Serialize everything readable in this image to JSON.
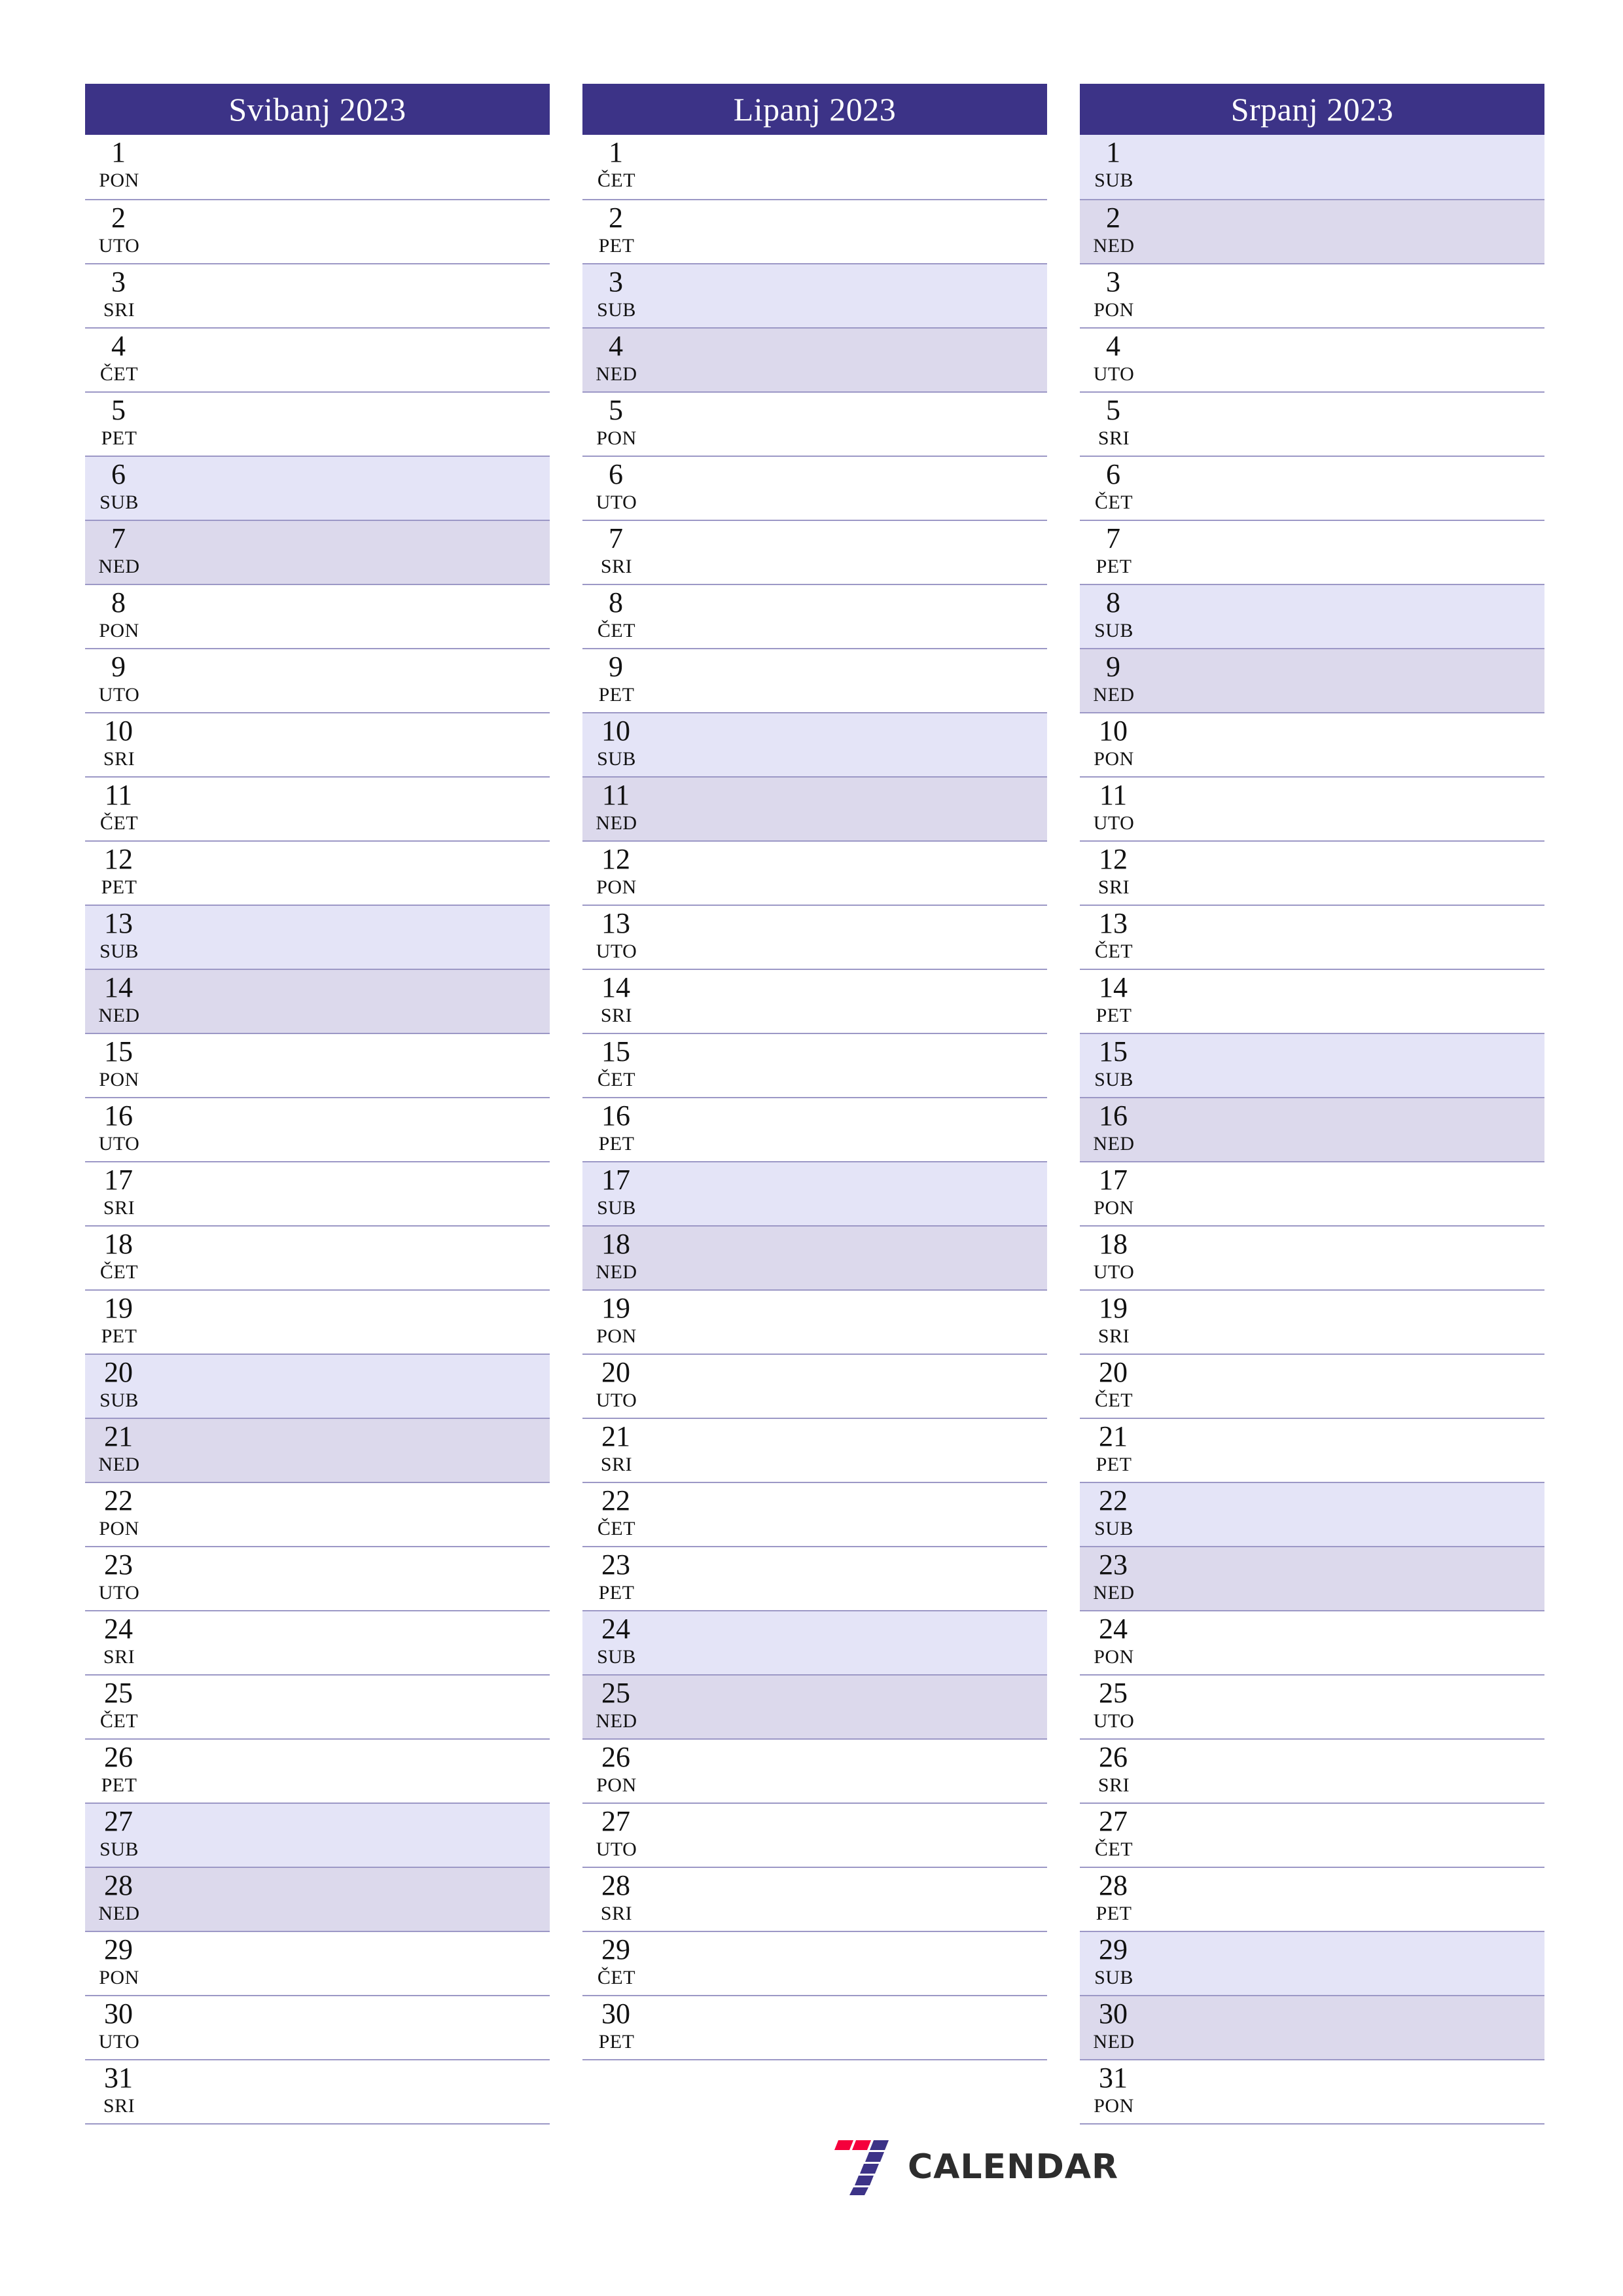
{
  "brand": {
    "logo_mark_name": "seven-logo-mark",
    "logo_text": "CALENDAR",
    "color_red": "#f5003c",
    "color_indigo": "#3c3387",
    "color_text": "#2d2d2d"
  },
  "theme": {
    "header_bg": "#3c3387",
    "header_text": "#ffffff",
    "saturday_bg": "#e4e4f7",
    "sunday_bg": "#dcd9ec",
    "rule_color": "#9c98c6",
    "day_text": "#111111",
    "page_bg": "#ffffff"
  },
  "language": "hr",
  "weekday_labels": {
    "mon": "PON",
    "tue": "UTO",
    "wed": "SRI",
    "thu": "ČET",
    "fri": "PET",
    "sat": "SUB",
    "sun": "NED"
  },
  "months": [
    {
      "title": "Svibanj 2023",
      "name": "Svibanj",
      "year": "2023",
      "days": [
        {
          "num": "1",
          "wd": "PON",
          "type": "weekday"
        },
        {
          "num": "2",
          "wd": "UTO",
          "type": "weekday"
        },
        {
          "num": "3",
          "wd": "SRI",
          "type": "weekday"
        },
        {
          "num": "4",
          "wd": "ČET",
          "type": "weekday"
        },
        {
          "num": "5",
          "wd": "PET",
          "type": "weekday"
        },
        {
          "num": "6",
          "wd": "SUB",
          "type": "sat"
        },
        {
          "num": "7",
          "wd": "NED",
          "type": "sun"
        },
        {
          "num": "8",
          "wd": "PON",
          "type": "weekday"
        },
        {
          "num": "9",
          "wd": "UTO",
          "type": "weekday"
        },
        {
          "num": "10",
          "wd": "SRI",
          "type": "weekday"
        },
        {
          "num": "11",
          "wd": "ČET",
          "type": "weekday"
        },
        {
          "num": "12",
          "wd": "PET",
          "type": "weekday"
        },
        {
          "num": "13",
          "wd": "SUB",
          "type": "sat"
        },
        {
          "num": "14",
          "wd": "NED",
          "type": "sun"
        },
        {
          "num": "15",
          "wd": "PON",
          "type": "weekday"
        },
        {
          "num": "16",
          "wd": "UTO",
          "type": "weekday"
        },
        {
          "num": "17",
          "wd": "SRI",
          "type": "weekday"
        },
        {
          "num": "18",
          "wd": "ČET",
          "type": "weekday"
        },
        {
          "num": "19",
          "wd": "PET",
          "type": "weekday"
        },
        {
          "num": "20",
          "wd": "SUB",
          "type": "sat"
        },
        {
          "num": "21",
          "wd": "NED",
          "type": "sun"
        },
        {
          "num": "22",
          "wd": "PON",
          "type": "weekday"
        },
        {
          "num": "23",
          "wd": "UTO",
          "type": "weekday"
        },
        {
          "num": "24",
          "wd": "SRI",
          "type": "weekday"
        },
        {
          "num": "25",
          "wd": "ČET",
          "type": "weekday"
        },
        {
          "num": "26",
          "wd": "PET",
          "type": "weekday"
        },
        {
          "num": "27",
          "wd": "SUB",
          "type": "sat"
        },
        {
          "num": "28",
          "wd": "NED",
          "type": "sun"
        },
        {
          "num": "29",
          "wd": "PON",
          "type": "weekday"
        },
        {
          "num": "30",
          "wd": "UTO",
          "type": "weekday"
        },
        {
          "num": "31",
          "wd": "SRI",
          "type": "weekday"
        }
      ]
    },
    {
      "title": "Lipanj 2023",
      "name": "Lipanj",
      "year": "2023",
      "days": [
        {
          "num": "1",
          "wd": "ČET",
          "type": "weekday"
        },
        {
          "num": "2",
          "wd": "PET",
          "type": "weekday"
        },
        {
          "num": "3",
          "wd": "SUB",
          "type": "sat"
        },
        {
          "num": "4",
          "wd": "NED",
          "type": "sun"
        },
        {
          "num": "5",
          "wd": "PON",
          "type": "weekday"
        },
        {
          "num": "6",
          "wd": "UTO",
          "type": "weekday"
        },
        {
          "num": "7",
          "wd": "SRI",
          "type": "weekday"
        },
        {
          "num": "8",
          "wd": "ČET",
          "type": "weekday"
        },
        {
          "num": "9",
          "wd": "PET",
          "type": "weekday"
        },
        {
          "num": "10",
          "wd": "SUB",
          "type": "sat"
        },
        {
          "num": "11",
          "wd": "NED",
          "type": "sun"
        },
        {
          "num": "12",
          "wd": "PON",
          "type": "weekday"
        },
        {
          "num": "13",
          "wd": "UTO",
          "type": "weekday"
        },
        {
          "num": "14",
          "wd": "SRI",
          "type": "weekday"
        },
        {
          "num": "15",
          "wd": "ČET",
          "type": "weekday"
        },
        {
          "num": "16",
          "wd": "PET",
          "type": "weekday"
        },
        {
          "num": "17",
          "wd": "SUB",
          "type": "sat"
        },
        {
          "num": "18",
          "wd": "NED",
          "type": "sun"
        },
        {
          "num": "19",
          "wd": "PON",
          "type": "weekday"
        },
        {
          "num": "20",
          "wd": "UTO",
          "type": "weekday"
        },
        {
          "num": "21",
          "wd": "SRI",
          "type": "weekday"
        },
        {
          "num": "22",
          "wd": "ČET",
          "type": "weekday"
        },
        {
          "num": "23",
          "wd": "PET",
          "type": "weekday"
        },
        {
          "num": "24",
          "wd": "SUB",
          "type": "sat"
        },
        {
          "num": "25",
          "wd": "NED",
          "type": "sun"
        },
        {
          "num": "26",
          "wd": "PON",
          "type": "weekday"
        },
        {
          "num": "27",
          "wd": "UTO",
          "type": "weekday"
        },
        {
          "num": "28",
          "wd": "SRI",
          "type": "weekday"
        },
        {
          "num": "29",
          "wd": "ČET",
          "type": "weekday"
        },
        {
          "num": "30",
          "wd": "PET",
          "type": "weekday"
        }
      ]
    },
    {
      "title": "Srpanj 2023",
      "name": "Srpanj",
      "year": "2023",
      "days": [
        {
          "num": "1",
          "wd": "SUB",
          "type": "sat"
        },
        {
          "num": "2",
          "wd": "NED",
          "type": "sun"
        },
        {
          "num": "3",
          "wd": "PON",
          "type": "weekday"
        },
        {
          "num": "4",
          "wd": "UTO",
          "type": "weekday"
        },
        {
          "num": "5",
          "wd": "SRI",
          "type": "weekday"
        },
        {
          "num": "6",
          "wd": "ČET",
          "type": "weekday"
        },
        {
          "num": "7",
          "wd": "PET",
          "type": "weekday"
        },
        {
          "num": "8",
          "wd": "SUB",
          "type": "sat"
        },
        {
          "num": "9",
          "wd": "NED",
          "type": "sun"
        },
        {
          "num": "10",
          "wd": "PON",
          "type": "weekday"
        },
        {
          "num": "11",
          "wd": "UTO",
          "type": "weekday"
        },
        {
          "num": "12",
          "wd": "SRI",
          "type": "weekday"
        },
        {
          "num": "13",
          "wd": "ČET",
          "type": "weekday"
        },
        {
          "num": "14",
          "wd": "PET",
          "type": "weekday"
        },
        {
          "num": "15",
          "wd": "SUB",
          "type": "sat"
        },
        {
          "num": "16",
          "wd": "NED",
          "type": "sun"
        },
        {
          "num": "17",
          "wd": "PON",
          "type": "weekday"
        },
        {
          "num": "18",
          "wd": "UTO",
          "type": "weekday"
        },
        {
          "num": "19",
          "wd": "SRI",
          "type": "weekday"
        },
        {
          "num": "20",
          "wd": "ČET",
          "type": "weekday"
        },
        {
          "num": "21",
          "wd": "PET",
          "type": "weekday"
        },
        {
          "num": "22",
          "wd": "SUB",
          "type": "sat"
        },
        {
          "num": "23",
          "wd": "NED",
          "type": "sun"
        },
        {
          "num": "24",
          "wd": "PON",
          "type": "weekday"
        },
        {
          "num": "25",
          "wd": "UTO",
          "type": "weekday"
        },
        {
          "num": "26",
          "wd": "SRI",
          "type": "weekday"
        },
        {
          "num": "27",
          "wd": "ČET",
          "type": "weekday"
        },
        {
          "num": "28",
          "wd": "PET",
          "type": "weekday"
        },
        {
          "num": "29",
          "wd": "SUB",
          "type": "sat"
        },
        {
          "num": "30",
          "wd": "NED",
          "type": "sun"
        },
        {
          "num": "31",
          "wd": "PON",
          "type": "weekday"
        }
      ]
    }
  ]
}
